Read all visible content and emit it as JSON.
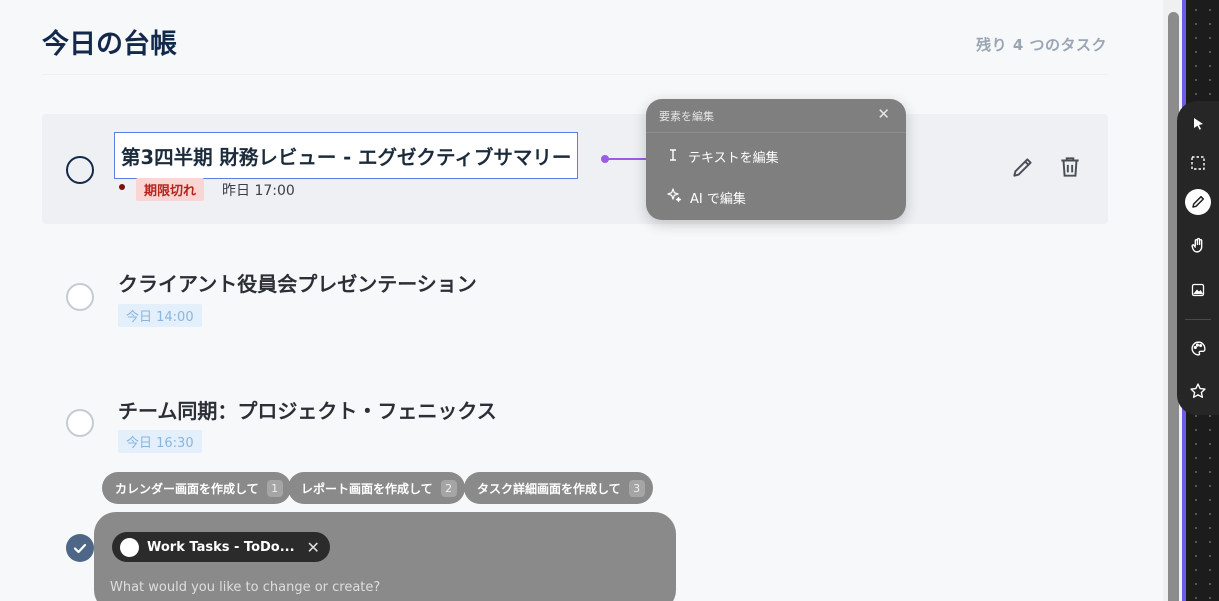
{
  "header": {
    "title": "今日の台帳",
    "remaining": "残り 4 つのタスク"
  },
  "tasks": [
    {
      "title": "第3四半期 財務レビュー - エグゼクティブサマリー",
      "status_badge": "期限切れ",
      "due": "昨日 17:00",
      "completed": false
    },
    {
      "title": "クライアント役員会プレゼンテーション",
      "due": "今日 14:00",
      "completed": false
    },
    {
      "title": "チーム同期：プロジェクト・フェニックス",
      "due": "今日 16:30",
      "completed": false
    },
    {
      "completed": true
    }
  ],
  "edit_popup": {
    "title": "要素を編集",
    "items": [
      {
        "label": "テキストを編集",
        "icon": "text-cursor-icon"
      },
      {
        "label": "AI で編集",
        "icon": "sparkle-icon"
      }
    ]
  },
  "suggestions": [
    {
      "label": "カレンダー画面を作成して",
      "num": "1"
    },
    {
      "label": "レポート画面を作成して",
      "num": "2"
    },
    {
      "label": "タスク詳細画面を作成して",
      "num": "3"
    }
  ],
  "prompt": {
    "context_chip": "Work Tasks - ToDo...",
    "placeholder": "What would you like to change or create?"
  },
  "toolbar": {
    "tools": [
      "pointer-icon",
      "marquee-select-icon",
      "pencil-icon",
      "hand-icon",
      "image-icon",
      "palette-icon",
      "star-icon"
    ],
    "active": "pencil-icon"
  },
  "colors": {
    "accent": "#6b5ce7",
    "overdue": "#b3261e",
    "selection": "#5b7fe6",
    "connector": "#9b5de5"
  }
}
